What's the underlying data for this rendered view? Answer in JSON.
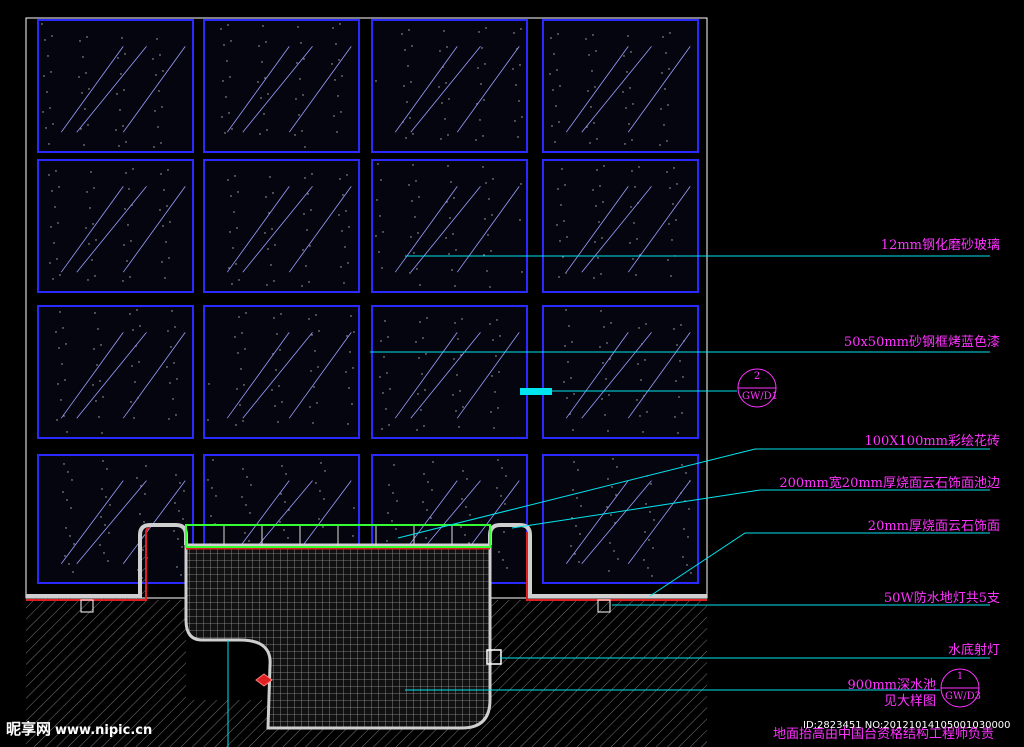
{
  "annotations": {
    "glass": "12mm钢化磨砂玻璃",
    "frame": "50x50mm砂钢框烤蓝色漆",
    "tile": "100X100mm彩绘花砖",
    "pool_edge": "200mm宽20mm厚烧面云石饰面池边",
    "stone_finish": "20mm厚烧面云石饰面",
    "floor_light": "50W防水地灯共5支",
    "underwater_light": "水底射灯",
    "pool_depth": "900mm深水池",
    "see_detail": "见大样图",
    "floor_raise": "地面抬高由中国台资格结构工程师负责"
  },
  "section_refs": [
    {
      "number": "2",
      "sheet": "GW/D1"
    },
    {
      "number": "1",
      "sheet": "GW/D3"
    }
  ],
  "watermark": {
    "logo_text": "昵享网",
    "url": "www.nipic.cn"
  },
  "image_id": "ID:2823451 NO:20121014105001030000",
  "colors": {
    "background": "#000000",
    "grid_frame": "#2a2aff",
    "outline": "#ffffff",
    "leader_line": "#00e5ee",
    "label_text": "#ff33ff",
    "red_line": "#e02020",
    "green_line": "#33ff33"
  }
}
